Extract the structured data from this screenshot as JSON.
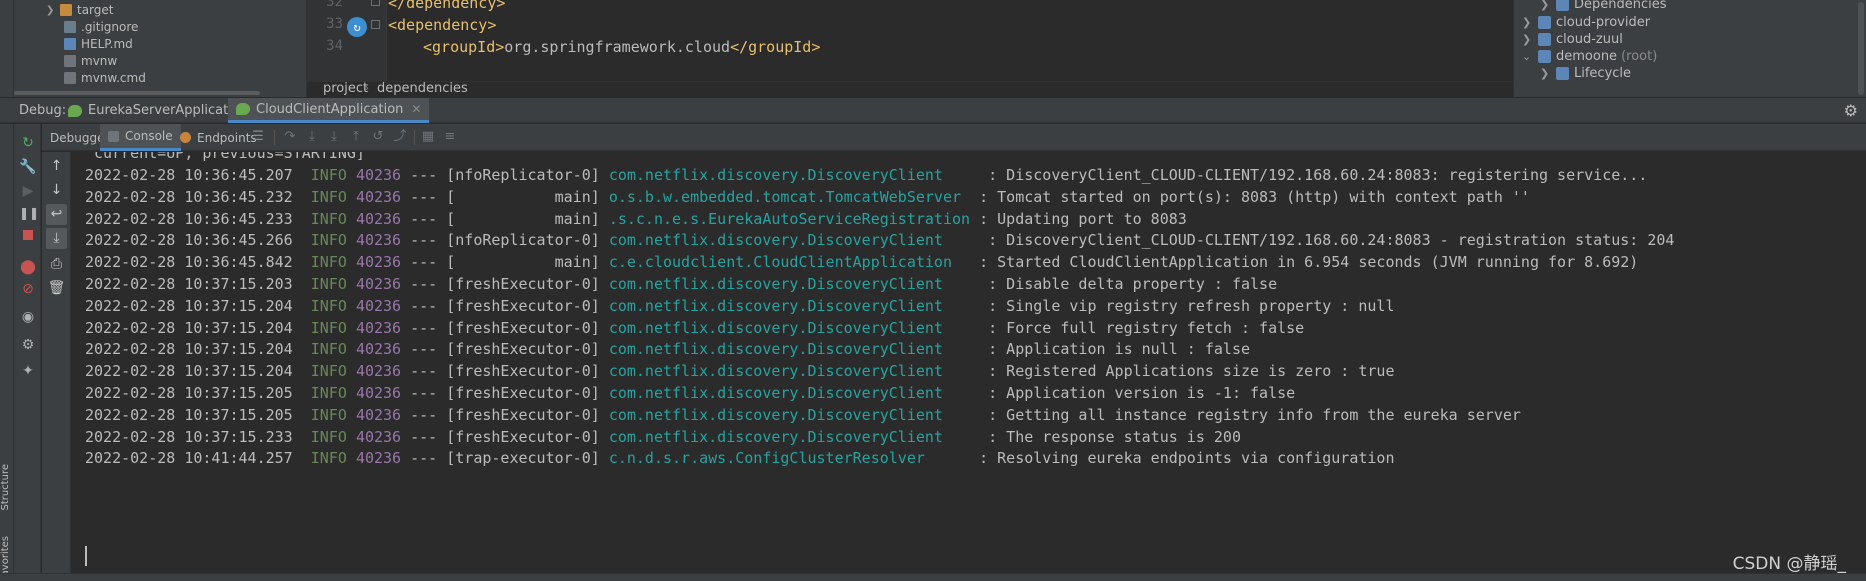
{
  "project_tree": {
    "items": [
      {
        "label": "target",
        "icon": "folder-icon"
      },
      {
        "label": ".gitignore",
        "icon": "file-icon"
      },
      {
        "label": "HELP.md",
        "icon": "markdown-file-icon"
      },
      {
        "label": "mvnw",
        "icon": "script-file-icon"
      },
      {
        "label": "mvnw.cmd",
        "icon": "script-file-icon"
      }
    ]
  },
  "editor": {
    "line_numbers": [
      "32",
      "33",
      "34"
    ],
    "lines": [
      {
        "open": "</",
        "tag": "dependency",
        "close": ">",
        "text": ""
      },
      {
        "open": "<",
        "tag": "dependency",
        "close": ">",
        "text": ""
      },
      {
        "open": "<",
        "tag": "groupId",
        "close": ">",
        "text": "org.springframework.cloud",
        "end": "</groupId>"
      }
    ],
    "breadcrumb": [
      "project",
      "dependencies"
    ]
  },
  "maven": {
    "items": [
      {
        "label": "Dependencies",
        "suffix": ""
      },
      {
        "label": "cloud-provider",
        "suffix": ""
      },
      {
        "label": "cloud-zuul",
        "suffix": ""
      },
      {
        "label": "demoone",
        "suffix": "(root)"
      },
      {
        "label": "Lifecycle",
        "suffix": ""
      }
    ]
  },
  "debug": {
    "label": "Debug:",
    "tabs": [
      {
        "label": "EurekaServerApplication",
        "active": false
      },
      {
        "label": "CloudClientApplication",
        "active": true
      }
    ]
  },
  "console_toolbar": {
    "tabs": [
      "Debugger",
      "Console",
      "Endpoints"
    ],
    "active_tab": "Console"
  },
  "console": {
    "first_line": " current=UP, previous=STARTING]",
    "lines": [
      {
        "ts": "2022-02-28 10:36:45.207",
        "level": "INFO",
        "pid": "40236",
        "sep": "---",
        "thread": "[nfoReplicator-0]",
        "logger": "com.netflix.discovery.DiscoveryClient    ",
        "msg": ": DiscoveryClient_CLOUD-CLIENT/192.168.60.24:8083: registering service..."
      },
      {
        "ts": "2022-02-28 10:36:45.232",
        "level": "INFO",
        "pid": "40236",
        "sep": "---",
        "thread": "[           main]",
        "logger": "o.s.b.w.embedded.tomcat.TomcatWebServer ",
        "msg": ": Tomcat started on port(s): 8083 (http) with context path ''"
      },
      {
        "ts": "2022-02-28 10:36:45.233",
        "level": "INFO",
        "pid": "40236",
        "sep": "---",
        "thread": "[           main]",
        "logger": ".s.c.n.e.s.EurekaAutoServiceRegistration",
        "msg": ": Updating port to 8083"
      },
      {
        "ts": "2022-02-28 10:36:45.266",
        "level": "INFO",
        "pid": "40236",
        "sep": "---",
        "thread": "[nfoReplicator-0]",
        "logger": "com.netflix.discovery.DiscoveryClient    ",
        "msg": ": DiscoveryClient_CLOUD-CLIENT/192.168.60.24:8083 - registration status: 204"
      },
      {
        "ts": "2022-02-28 10:36:45.842",
        "level": "INFO",
        "pid": "40236",
        "sep": "---",
        "thread": "[           main]",
        "logger": "c.e.cloudclient.CloudClientApplication  ",
        "msg": ": Started CloudClientApplication in 6.954 seconds (JVM running for 8.692)"
      },
      {
        "ts": "2022-02-28 10:37:15.203",
        "level": "INFO",
        "pid": "40236",
        "sep": "---",
        "thread": "[freshExecutor-0]",
        "logger": "com.netflix.discovery.DiscoveryClient    ",
        "msg": ": Disable delta property : false"
      },
      {
        "ts": "2022-02-28 10:37:15.204",
        "level": "INFO",
        "pid": "40236",
        "sep": "---",
        "thread": "[freshExecutor-0]",
        "logger": "com.netflix.discovery.DiscoveryClient    ",
        "msg": ": Single vip registry refresh property : null"
      },
      {
        "ts": "2022-02-28 10:37:15.204",
        "level": "INFO",
        "pid": "40236",
        "sep": "---",
        "thread": "[freshExecutor-0]",
        "logger": "com.netflix.discovery.DiscoveryClient    ",
        "msg": ": Force full registry fetch : false"
      },
      {
        "ts": "2022-02-28 10:37:15.204",
        "level": "INFO",
        "pid": "40236",
        "sep": "---",
        "thread": "[freshExecutor-0]",
        "logger": "com.netflix.discovery.DiscoveryClient    ",
        "msg": ": Application is null : false"
      },
      {
        "ts": "2022-02-28 10:37:15.204",
        "level": "INFO",
        "pid": "40236",
        "sep": "---",
        "thread": "[freshExecutor-0]",
        "logger": "com.netflix.discovery.DiscoveryClient    ",
        "msg": ": Registered Applications size is zero : true"
      },
      {
        "ts": "2022-02-28 10:37:15.205",
        "level": "INFO",
        "pid": "40236",
        "sep": "---",
        "thread": "[freshExecutor-0]",
        "logger": "com.netflix.discovery.DiscoveryClient    ",
        "msg": ": Application version is -1: false"
      },
      {
        "ts": "2022-02-28 10:37:15.205",
        "level": "INFO",
        "pid": "40236",
        "sep": "---",
        "thread": "[freshExecutor-0]",
        "logger": "com.netflix.discovery.DiscoveryClient    ",
        "msg": ": Getting all instance registry info from the eureka server"
      },
      {
        "ts": "2022-02-28 10:37:15.233",
        "level": "INFO",
        "pid": "40236",
        "sep": "---",
        "thread": "[freshExecutor-0]",
        "logger": "com.netflix.discovery.DiscoveryClient    ",
        "msg": ": The response status is 200"
      },
      {
        "ts": "2022-02-28 10:41:44.257",
        "level": "INFO",
        "pid": "40236",
        "sep": "---",
        "thread": "[trap-executor-0]",
        "logger": "c.n.d.s.r.aws.ConfigClusterResolver     ",
        "msg": ": Resolving eureka endpoints via configuration"
      }
    ]
  },
  "side_panel": {
    "structure_label": "Structure",
    "favorites_label": "Favorites"
  },
  "watermark": "CSDN @静瑶_",
  "colors": {
    "info": "#6a8759",
    "pid": "#9876aa",
    "logger": "#23a4a1",
    "active_tab_underline": "#4a88c7"
  }
}
